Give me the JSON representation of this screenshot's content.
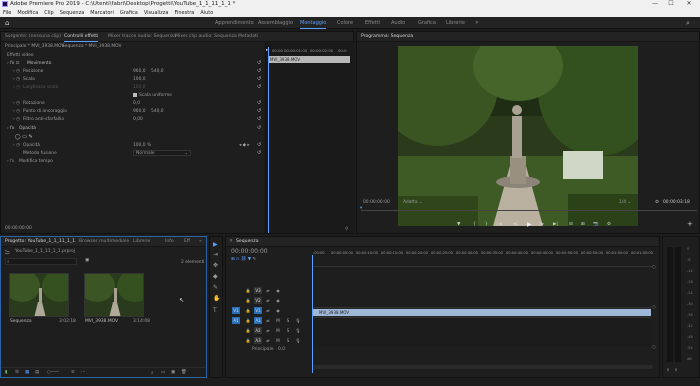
{
  "titlebar": {
    "title": "Adobe Premiere Pro 2019 - C:\\Utenti\\fabri\\Desktop\\Progetti\\YouTube_1_1_11_1_1 *",
    "minimize": "—",
    "maximize": "☐",
    "close": "✕"
  },
  "menu": [
    "File",
    "Modifica",
    "Clip",
    "Sequenza",
    "Marcatori",
    "Grafica",
    "Visualizza",
    "Finestra",
    "Aiuto"
  ],
  "workspaces": [
    "Apprendimento",
    "Assemblaggio",
    "Montaggio",
    "Colore",
    "Effetti",
    "Audio",
    "Grafica",
    "Librerie"
  ],
  "workspace_more": "»",
  "source_panel": {
    "tabs": [
      "Sorgente: (nessuna clip)",
      "Controlli effetti",
      "Mixer tracce audio: Sequenza",
      "Mixer clip audio: Sequenza",
      "Metadati"
    ],
    "breadcrumb_master": "Principale * MVI_3938.MOV",
    "breadcrumb_seq": "Sequenza * MVI_3938.MOV",
    "section_video": "Effetti video",
    "fx_motion": "Movimento",
    "rows": [
      {
        "label": "Posizione",
        "v1": "960,0",
        "v2": "540,0"
      },
      {
        "label": "Scala",
        "v1": "100,0",
        "v2": ""
      },
      {
        "label": "Larghezza scala",
        "v1": "100,0",
        "v2": ""
      },
      {
        "label": "Rotazione",
        "v1": "0,0",
        "v2": ""
      },
      {
        "label": "Punto di ancoraggio",
        "v1": "960,0",
        "v2": "540,0"
      },
      {
        "label": "Filtro anti-sfarfallio",
        "v1": "0,00",
        "v2": ""
      }
    ],
    "uniform_scale": "Scala uniforme",
    "fx_opacity": "Opacità",
    "opacity_label": "Opacità",
    "opacity_value": "100,0 %",
    "blend_label": "Metodo fusione",
    "blend_value": "Normale",
    "fx_remap": "Modifica tempo",
    "mini_clip": "MVI_3938.MOV",
    "mini_times": [
      "00:00",
      "00:00:01:00",
      "00:00:02:00",
      "00:0"
    ],
    "timecode": "00:00:00:00"
  },
  "program": {
    "title": "Programma: Sequenza",
    "timecode": "00:00:00:00",
    "fit": "Adatta",
    "quality": "1/4",
    "duration": "00:00:03:18",
    "controls": [
      "▼",
      "{",
      "}",
      "|◀",
      "◀|",
      "▶",
      "|▶",
      "▶|",
      "⊟",
      "⊞",
      "📷",
      "⚙"
    ],
    "add": "+"
  },
  "project": {
    "tabs": [
      "Progetto: YouTube_1_1_11_1_1",
      "Browser multimediale",
      "Librerie",
      "Info",
      "Eff"
    ],
    "more": "»",
    "file": "YouTube_1_1_11_1_1.prproj",
    "items_count": "2 elementi",
    "items": [
      {
        "name": "Sequenza",
        "duration": "3:02:18"
      },
      {
        "name": "MVI_3938.MOV",
        "duration": "3:14:08"
      }
    ]
  },
  "tools": [
    "▶",
    "⇥",
    "✥",
    "◆",
    "✎",
    "✋",
    "T"
  ],
  "timeline": {
    "title": "Sequenza",
    "timecode": "00:00:00:00",
    "ruler": [
      ":00:00",
      "00:00:05:00",
      "00:00:10:00",
      "00:00:15:00",
      "00:00:20:00",
      "00:00:25:00",
      "00:00:30:00",
      "00:00:35:00",
      "00:00:40:00",
      "00:00:45:00",
      "00:00:50:00",
      "00:00:55:00",
      "00:01:00:00",
      "00:01:05:00"
    ],
    "video_tracks": [
      "V3",
      "V2",
      "V1"
    ],
    "audio_tracks": [
      "A1",
      "A2",
      "A3"
    ],
    "src_v": "V1",
    "src_a": "A1",
    "master": "Principale",
    "master_val": "0,0",
    "clip_video": "MVI_3938.MOV"
  },
  "meter": {
    "labels": [
      "0",
      "-6",
      "-12",
      "-18",
      "-24",
      "-30",
      "-36",
      "-42",
      "-48",
      "-54",
      "dB"
    ],
    "solo": "S",
    "solo2": "S"
  },
  "colors": {
    "accent": "#5aa0ff",
    "clip_video": "#9fb8d8",
    "track_target": "#2a6fb5"
  }
}
